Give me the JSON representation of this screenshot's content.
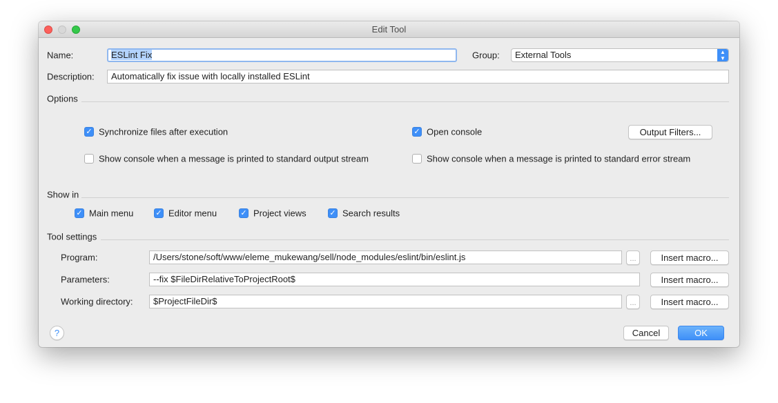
{
  "window": {
    "title": "Edit Tool"
  },
  "name": {
    "label": "Name:",
    "value": "ESLint Fix"
  },
  "group": {
    "label": "Group:",
    "value": "External Tools"
  },
  "description": {
    "label": "Description:",
    "value": "Automatically fix issue with locally installed ESLint"
  },
  "options": {
    "header": "Options",
    "sync": {
      "label": "Synchronize files after execution",
      "checked": true
    },
    "open_console": {
      "label": "Open console",
      "checked": true
    },
    "output_filters": "Output Filters...",
    "show_stdout": {
      "label": "Show console when a message is printed to standard output stream",
      "checked": false
    },
    "show_stderr": {
      "label": "Show console when a message is printed to standard error stream",
      "checked": false
    }
  },
  "show_in": {
    "header": "Show in",
    "items": [
      {
        "label": "Main menu",
        "checked": true
      },
      {
        "label": "Editor menu",
        "checked": true
      },
      {
        "label": "Project views",
        "checked": true
      },
      {
        "label": "Search results",
        "checked": true
      }
    ]
  },
  "tool_settings": {
    "header": "Tool settings",
    "program": {
      "label": "Program:",
      "value": "/Users/stone/soft/www/eleme_mukewang/sell/node_modules/eslint/bin/eslint.js"
    },
    "parameters": {
      "label": "Parameters:",
      "value": "--fix $FileDirRelativeToProjectRoot$"
    },
    "working_dir": {
      "label": "Working directory:",
      "value": "$ProjectFileDir$"
    },
    "browse": "...",
    "insert_macro": "Insert macro..."
  },
  "footer": {
    "help": "?",
    "cancel": "Cancel",
    "ok": "OK"
  },
  "colors": {
    "accent": "#3e8ff8",
    "ok_button": "#4a9bfb"
  }
}
